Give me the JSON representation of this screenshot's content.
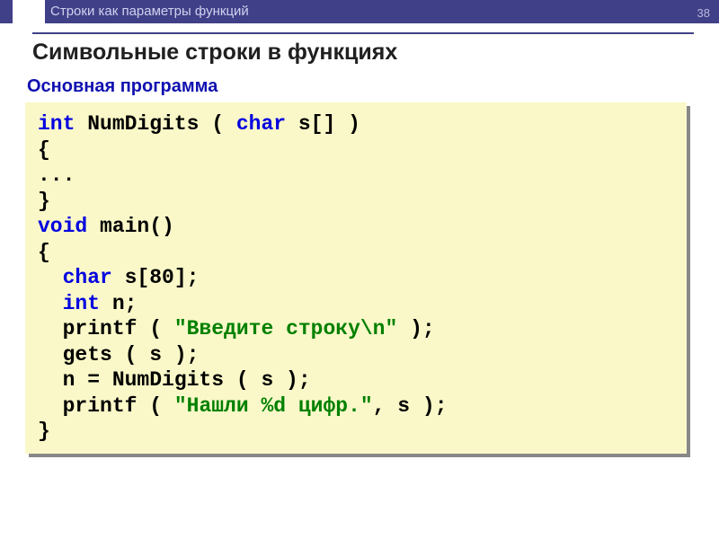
{
  "header": {
    "breadcrumb": "Строки как параметры функций",
    "page_number": "38"
  },
  "title": "Символьные строки в функциях",
  "subtitle": "Основная программа",
  "code": {
    "l1_kw": "int",
    "l1_rest": " NumDigits ( ",
    "l1_kw2": "char",
    "l1_end": " s[] )",
    "l2": "{",
    "l3": "...",
    "l4": "}",
    "l5_kw": "void",
    "l5_rest": " main()",
    "l6": "{",
    "l7_indent": "  ",
    "l7_kw": "char",
    "l7_rest": " s[80];",
    "l8_indent": "  ",
    "l8_kw": "int",
    "l8_rest": " n;",
    "l9_indent": "  ",
    "l9_a": "printf ( ",
    "l9_str": "\"Введите строку\\n\"",
    "l9_b": " );",
    "l10": "  gets ( s );",
    "l11": "  n = NumDigits ( s );",
    "l12_indent": "  ",
    "l12_a": "printf ( ",
    "l12_str": "\"Нашли %d цифр.\"",
    "l12_b": ", s );",
    "l13": "}"
  }
}
